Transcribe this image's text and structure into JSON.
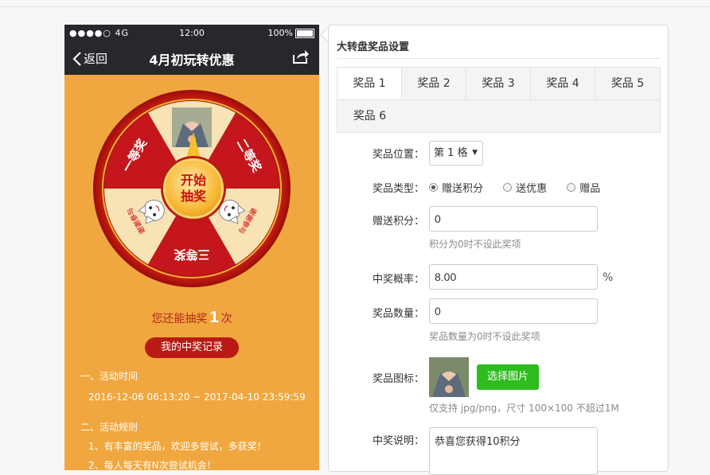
{
  "phone": {
    "status": {
      "signal": "●●●●○ 4G",
      "time": "12:00",
      "battery": "100%"
    },
    "nav": {
      "back_label": "返回",
      "title": "4月初玩转优惠"
    },
    "wheel": {
      "segments": [
        "一等奖",
        "二等奖",
        "谢谢参与",
        "三等奖",
        "谢谢参与"
      ],
      "spin_label_line1": "开始",
      "spin_label_line2": "抽奖",
      "colors": {
        "red": "#c4161c",
        "cream": "#f7e3b5",
        "rim": "#d81f18"
      }
    },
    "remain": {
      "prefix": "您还能抽奖",
      "count": "1",
      "suffix": "次"
    },
    "record_button": "我的中奖记录",
    "rules": {
      "section1_title": "一、活动时间",
      "time_range": "2016-12-06 06:13:20 ~ 2017-04-10 23:59:59",
      "section2_title": "二、活动规则",
      "rule1": "1、有丰富的奖品，欢迎多尝试，多获奖！",
      "rule2": "2、每人每天有N次尝试机会！"
    }
  },
  "panel": {
    "title": "大转盘奖品设置",
    "tabs": [
      "奖品 1",
      "奖品 2",
      "奖品 3",
      "奖品 4",
      "奖品 5",
      "奖品 6"
    ],
    "active_tab": "奖品 1",
    "form": {
      "position_label": "奖品位置：",
      "position_value": "第 1 格",
      "type_label": "奖品类型：",
      "type_options": [
        "赠送积分",
        "送优惠",
        "赠品"
      ],
      "type_selected": "赠送积分",
      "points_label": "赠送积分：",
      "points_value": "0",
      "points_hint": "积分为0时不设此奖项",
      "prob_label": "中奖概率：",
      "prob_value": "8.00",
      "prob_unit": "%",
      "qty_label": "奖品数量：",
      "qty_value": "0",
      "qty_hint": "奖品数量为0时不设此奖项",
      "icon_label": "奖品图标：",
      "icon_button": "选择图片",
      "icon_hint": "仅支持 jpg/png，尺寸 100×100 不超过1M",
      "desc_label": "中奖说明：",
      "desc_value": "恭喜您获得10积分"
    }
  }
}
